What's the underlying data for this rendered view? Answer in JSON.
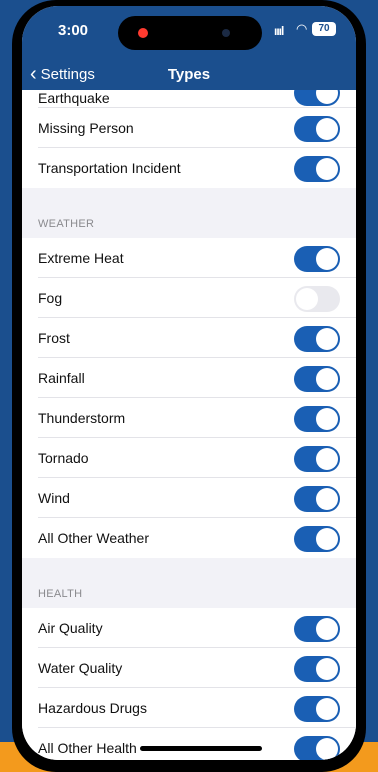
{
  "status": {
    "time": "3:00",
    "battery": "70",
    "signal": "ıııl"
  },
  "nav": {
    "back_label": "Settings",
    "title": "Types"
  },
  "groups": [
    {
      "header": "",
      "items": [
        {
          "label": "Earthquake",
          "on": true
        },
        {
          "label": "Missing Person",
          "on": true
        },
        {
          "label": "Transportation Incident",
          "on": true
        }
      ]
    },
    {
      "header": "WEATHER",
      "items": [
        {
          "label": "Extreme Heat",
          "on": true
        },
        {
          "label": "Fog",
          "on": false
        },
        {
          "label": "Frost",
          "on": true
        },
        {
          "label": "Rainfall",
          "on": true
        },
        {
          "label": "Thunderstorm",
          "on": true
        },
        {
          "label": "Tornado",
          "on": true
        },
        {
          "label": "Wind",
          "on": true
        },
        {
          "label": "All Other Weather",
          "on": true
        }
      ]
    },
    {
      "header": "HEALTH",
      "items": [
        {
          "label": "Air Quality",
          "on": true
        },
        {
          "label": "Water Quality",
          "on": true
        },
        {
          "label": "Hazardous Drugs",
          "on": true
        },
        {
          "label": "All Other Health",
          "on": true
        }
      ]
    }
  ],
  "colors": {
    "accent": "#1a5fb4",
    "navbar": "#1b4f8e",
    "toggle_off": "#e9e9ee"
  }
}
